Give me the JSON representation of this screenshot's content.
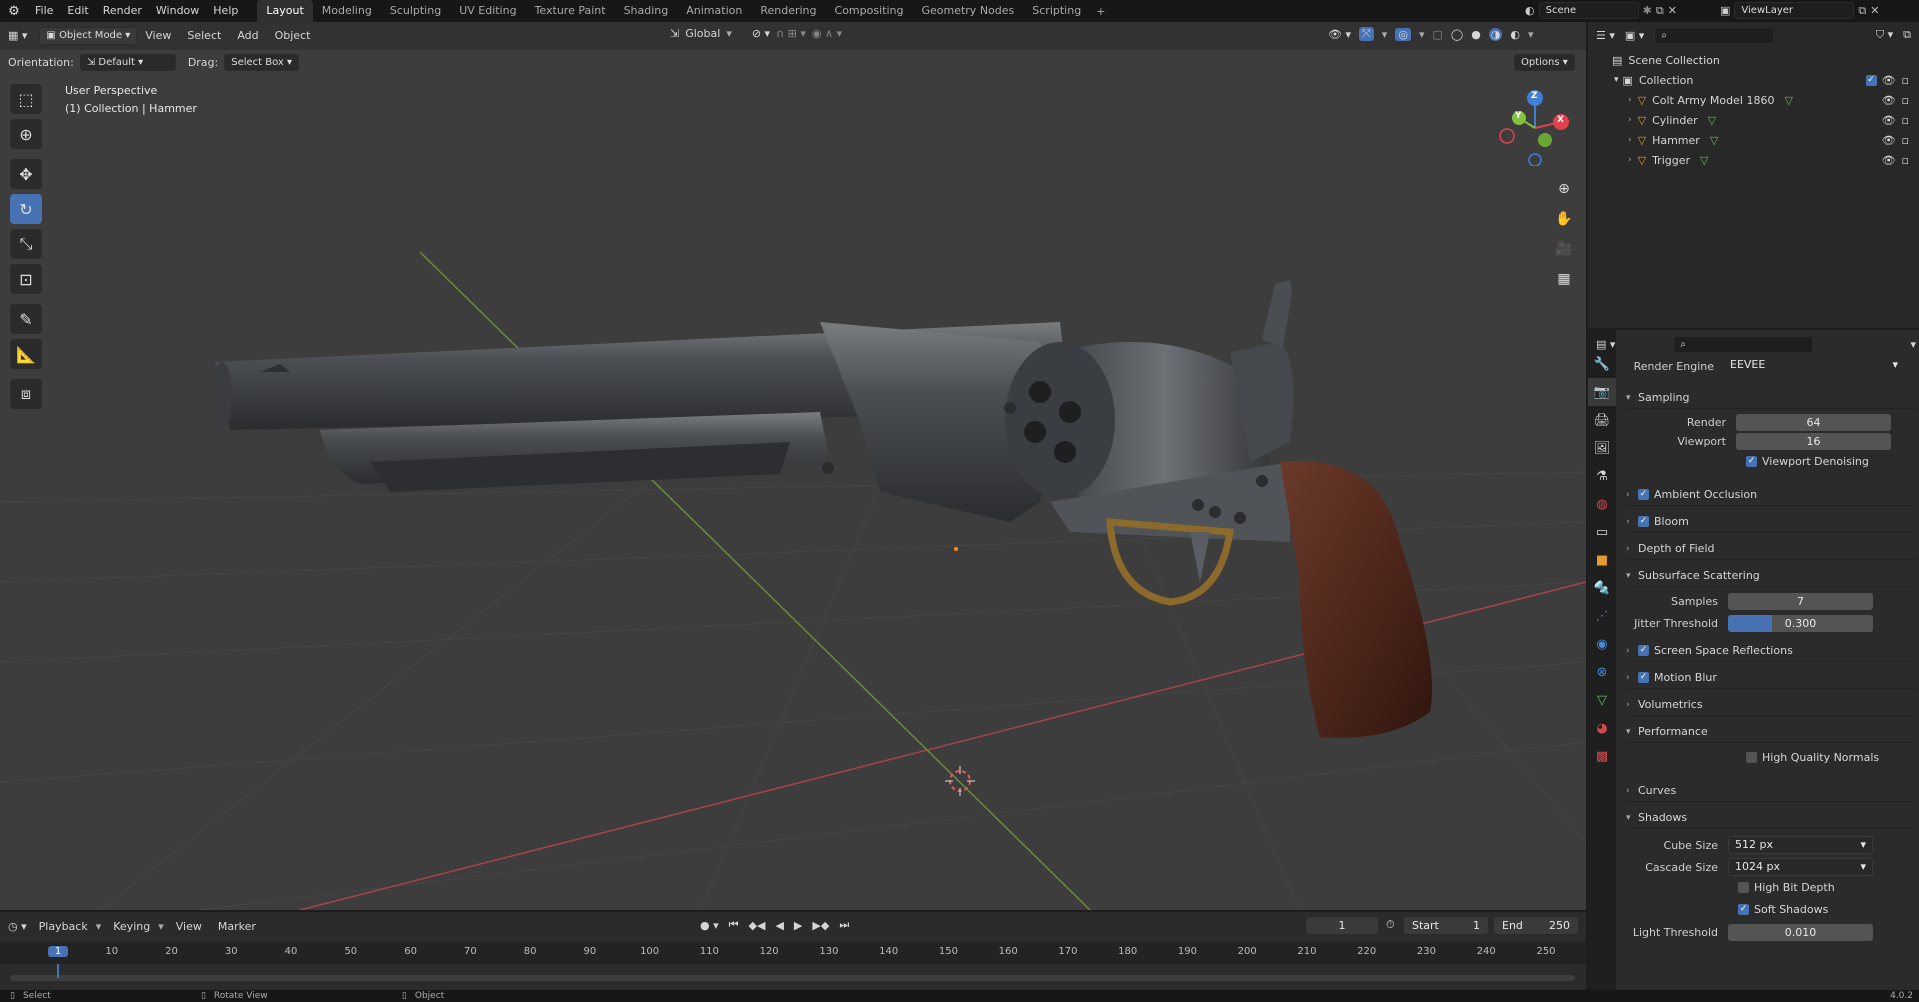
{
  "topbar": {
    "menus": [
      "File",
      "Edit",
      "Render",
      "Window",
      "Help"
    ],
    "workspaces": [
      "Layout",
      "Modeling",
      "Sculpting",
      "UV Editing",
      "Texture Paint",
      "Shading",
      "Animation",
      "Rendering",
      "Compositing",
      "Geometry Nodes",
      "Scripting"
    ],
    "active_workspace": "Layout",
    "scene": "Scene",
    "view_layer": "ViewLayer"
  },
  "viewport": {
    "mode": "Object Mode",
    "menus": [
      "View",
      "Select",
      "Add",
      "Object"
    ],
    "transform_orientation": "Global",
    "orientation_label": "Orientation:",
    "orientation_value": "Default",
    "drag_label": "Drag:",
    "drag_value": "Select Box",
    "options_label": "Options",
    "overlay_line1": "User Perspective",
    "overlay_line2": "(1) Collection | Hammer",
    "gizmo": {
      "x": "X",
      "y": "Y",
      "z": "Z"
    }
  },
  "outliner": {
    "root": "Scene Collection",
    "collection": "Collection",
    "items": [
      "Colt Army Model 1860",
      "Cylinder",
      "Hammer",
      "Trigger"
    ]
  },
  "properties": {
    "render_engine_label": "Render Engine",
    "render_engine": "EEVEE",
    "sampling": {
      "title": "Sampling",
      "render_label": "Render",
      "render": "64",
      "viewport_label": "Viewport",
      "viewport": "16",
      "denoise_label": "Viewport Denoising",
      "denoise": true
    },
    "ambient_occlusion": "Ambient Occlusion",
    "bloom": "Bloom",
    "depth_of_field": "Depth of Field",
    "sss": {
      "title": "Subsurface Scattering",
      "samples_label": "Samples",
      "samples": "7",
      "jitter_label": "Jitter Threshold",
      "jitter": "0.300",
      "jitter_fraction": 0.3
    },
    "ssr": "Screen Space Reflections",
    "motion_blur": "Motion Blur",
    "volumetrics": "Volumetrics",
    "performance": {
      "title": "Performance",
      "hq_normals_label": "High Quality Normals",
      "hq_normals": false
    },
    "curves": "Curves",
    "shadows": {
      "title": "Shadows",
      "cube_label": "Cube Size",
      "cube": "512 px",
      "cascade_label": "Cascade Size",
      "cascade": "1024 px",
      "high_bit_label": "High Bit Depth",
      "high_bit": false,
      "soft_label": "Soft Shadows",
      "soft": true,
      "light_threshold_label": "Light Threshold",
      "light_threshold": "0.010"
    }
  },
  "timeline": {
    "menus": [
      "Playback",
      "Keying",
      "View",
      "Marker"
    ],
    "current_frame": "1",
    "start_label": "Start",
    "start": "1",
    "end_label": "End",
    "end": "250",
    "ruler": [
      "1",
      "10",
      "20",
      "30",
      "40",
      "50",
      "60",
      "70",
      "80",
      "90",
      "100",
      "110",
      "120",
      "130",
      "140",
      "150",
      "160",
      "170",
      "180",
      "190",
      "200",
      "210",
      "220",
      "230",
      "240",
      "250"
    ]
  },
  "statusbar": {
    "select": "Select",
    "rotate": "Rotate View",
    "object": "Object",
    "version": "4.0.2"
  },
  "colors": {
    "accent": "#4772b3",
    "x_axis": "#e0414c",
    "y_axis": "#82c43f",
    "z_axis": "#3f80d6"
  }
}
